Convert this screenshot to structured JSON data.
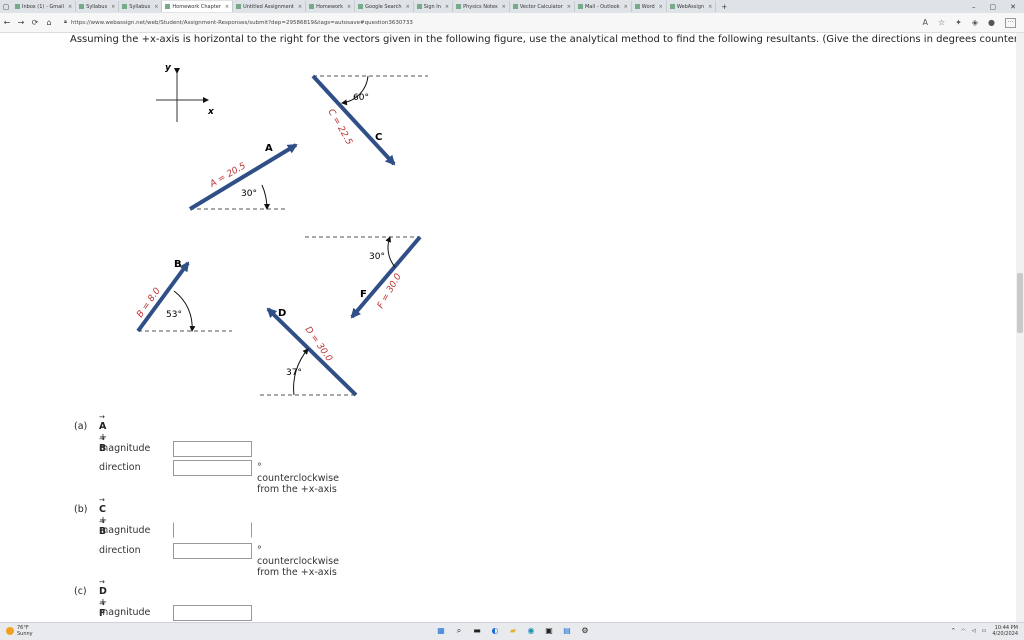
{
  "browser": {
    "tabs": [
      {
        "label": "Inbox (1) - Gmail"
      },
      {
        "label": "Syllabus"
      },
      {
        "label": "Syllabus"
      },
      {
        "label": "Homework Chapter"
      },
      {
        "label": "Untitled Assignment"
      },
      {
        "label": "Homework"
      },
      {
        "label": "Google Search"
      },
      {
        "label": "Sign In"
      },
      {
        "label": "Physics Notes"
      },
      {
        "label": "Vector Calculator"
      },
      {
        "label": "Mail - Outlook"
      },
      {
        "label": "Word"
      },
      {
        "label": "WebAssign"
      }
    ],
    "active_tab_index": 3,
    "url": "https://www.webassign.net/web/Student/Assignment-Responses/submit?dep=29586819&tags=autosave#question3630733"
  },
  "question": {
    "text": "Assuming the +x-axis is horizontal to the right for the vectors given in the following figure, use the analytical method to find the following resultants. (Give the directions in degrees counterclockwise from the +x-axis.)"
  },
  "figure": {
    "axes": {
      "y": "y",
      "x": "x"
    },
    "vectors": {
      "A": {
        "name": "A",
        "label": "A = 20.5",
        "angle": "30°"
      },
      "B": {
        "name": "B",
        "label": "B = 8.0",
        "angle": "53°"
      },
      "C": {
        "name": "C",
        "label": "C = 22.5",
        "angle": "60°"
      },
      "D": {
        "name": "D",
        "label": "D = 30.0",
        "angle": "37°"
      },
      "F": {
        "name": "F",
        "label": "F = 30.0",
        "angle": "30°"
      }
    },
    "color": "#2f4f86"
  },
  "parts": [
    {
      "label": "(a)",
      "v1": "A",
      "op": "+",
      "v2": "B",
      "magnitude_label": "magnitude",
      "direction_label": "direction",
      "magnitude_value": "",
      "direction_value": "",
      "unit_text": "° counterclockwise from the +x-axis"
    },
    {
      "label": "(b)",
      "v1": "C",
      "op": "+",
      "v2": "B",
      "magnitude_label": "magnitude",
      "direction_label": "direction",
      "magnitude_value": "",
      "direction_value": "",
      "unit_text": "° counterclockwise from the +x-axis"
    },
    {
      "label": "(c)",
      "v1": "D",
      "op": "+",
      "v2": "F",
      "magnitude_label": "magnitude",
      "magnitude_value": ""
    }
  ],
  "taskbar": {
    "weather_temp": "76°F",
    "weather_desc": "Sunny",
    "time": "10:44 PM",
    "date": "4/20/2024"
  }
}
